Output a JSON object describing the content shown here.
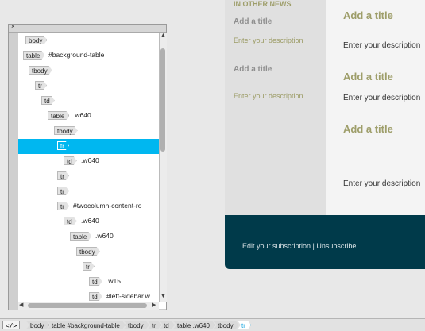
{
  "preview": {
    "side": {
      "heading": "IN OTHER NEWS",
      "title1": "Add a title",
      "desc1": "Enter your description",
      "title2": "Add a title",
      "desc2": "Enter your description"
    },
    "main": {
      "title1": "Add a title",
      "desc1": "Enter your description",
      "title2": "Add a title",
      "desc2": "Enter your description",
      "title3": "Add a title",
      "desc3": "Enter your description"
    },
    "footer": {
      "text": "Edit your subscription | Unsubscribe"
    }
  },
  "tree_panel": {
    "close_label": "×",
    "nodes": [
      {
        "tag": "body",
        "attr": ""
      },
      {
        "tag": "table",
        "attr": "#background-table"
      },
      {
        "tag": "tbody",
        "attr": ""
      },
      {
        "tag": "tr",
        "attr": ""
      },
      {
        "tag": "td",
        "attr": ""
      },
      {
        "tag": "table",
        "attr": ".w640"
      },
      {
        "tag": "tbody",
        "attr": ""
      },
      {
        "tag": "tr",
        "attr": "",
        "selected": true
      },
      {
        "tag": "td",
        "attr": ".w640"
      },
      {
        "tag": "tr",
        "attr": ""
      },
      {
        "tag": "tr",
        "attr": ""
      },
      {
        "tag": "tr",
        "attr": "#twocolumn-content-ro"
      },
      {
        "tag": "td",
        "attr": ".w640"
      },
      {
        "tag": "table",
        "attr": ".w640"
      },
      {
        "tag": "tbody",
        "attr": ""
      },
      {
        "tag": "tr",
        "attr": ""
      },
      {
        "tag": "td",
        "attr": ".w15"
      },
      {
        "tag": "td",
        "attr": "#left-sidebar.w"
      }
    ],
    "scroll": {
      "up": "▲",
      "down": "▼",
      "left": "◀",
      "right": "▶"
    }
  },
  "tagbar": {
    "code_label": "</>",
    "crumbs": [
      {
        "tag": "body",
        "attr": ""
      },
      {
        "tag": "table",
        "attr": "#background-table"
      },
      {
        "tag": "tbody",
        "attr": ""
      },
      {
        "tag": "tr",
        "attr": ""
      },
      {
        "tag": "td",
        "attr": ""
      },
      {
        "tag": "table",
        "attr": ".w640"
      },
      {
        "tag": "tbody",
        "attr": ""
      },
      {
        "tag": "tr",
        "attr": "",
        "selected": true
      }
    ]
  },
  "colors": {
    "selection": "#00b7f0",
    "footer_band": "#003a4a",
    "title_olive": "#9e9e6a"
  }
}
